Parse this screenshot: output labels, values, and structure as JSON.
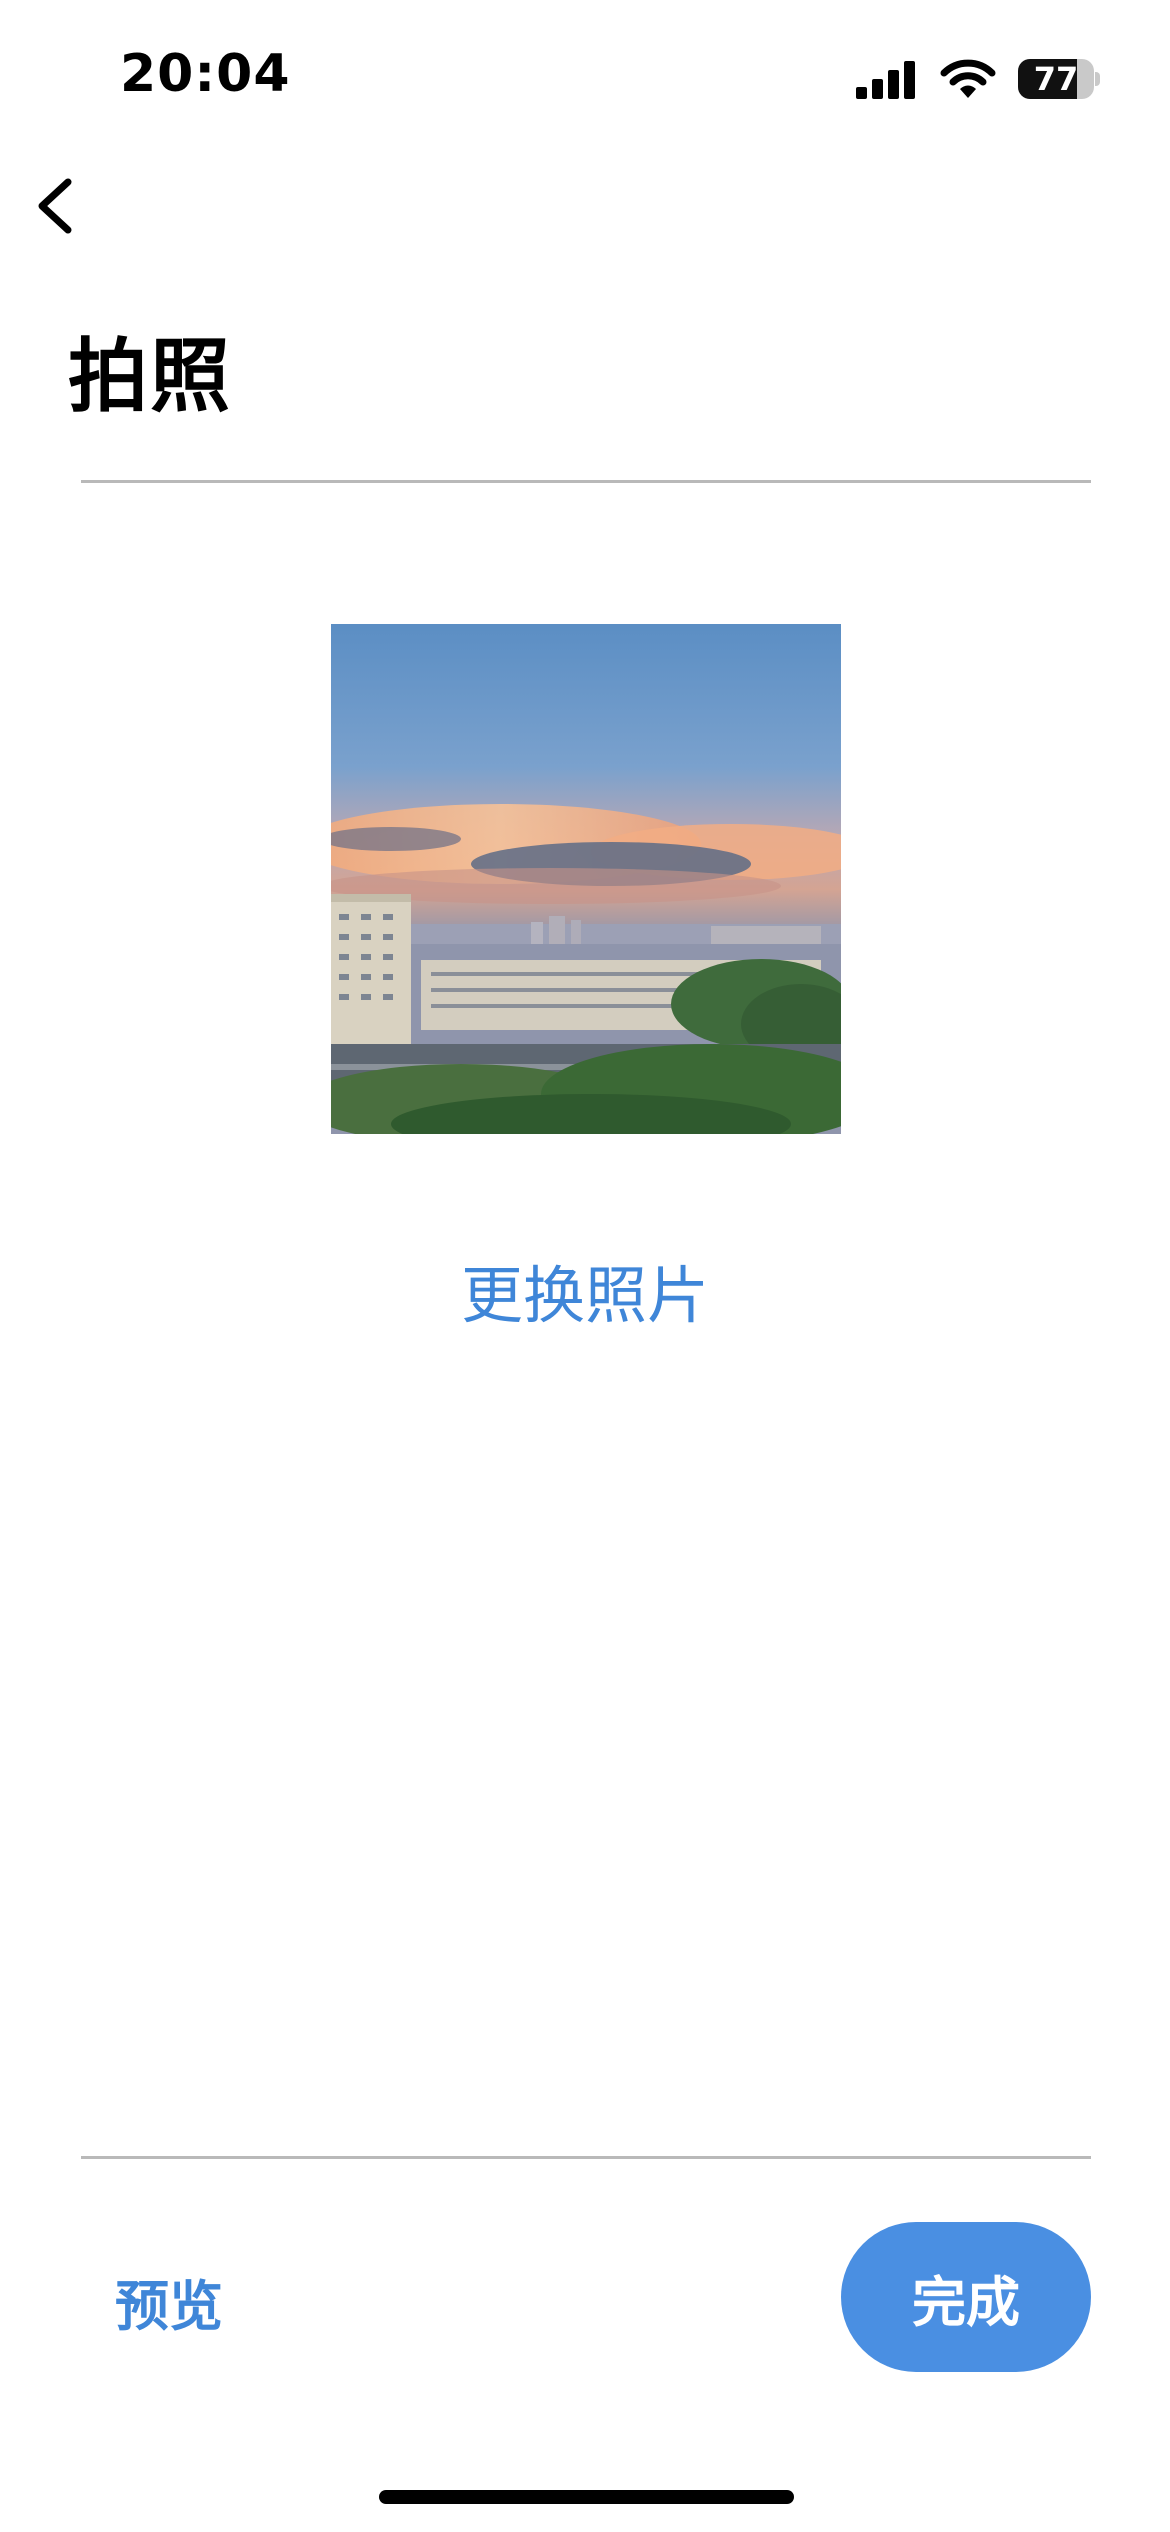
{
  "status_bar": {
    "time": "20:04",
    "battery_percent": "77",
    "battery_level": 0.77,
    "icons": [
      "cellular-signal-icon",
      "wifi-icon",
      "battery-icon"
    ]
  },
  "nav": {
    "back_icon": "chevron-left-icon"
  },
  "page": {
    "title": "拍照"
  },
  "photo": {
    "description_icon": "photo-thumbnail"
  },
  "actions": {
    "change_photo": "更换照片",
    "preview": "预览",
    "done": "完成"
  },
  "colors": {
    "accent": "#3f86d8",
    "button_bg": "#4a8fe2",
    "divider": "#b9b9b9"
  }
}
